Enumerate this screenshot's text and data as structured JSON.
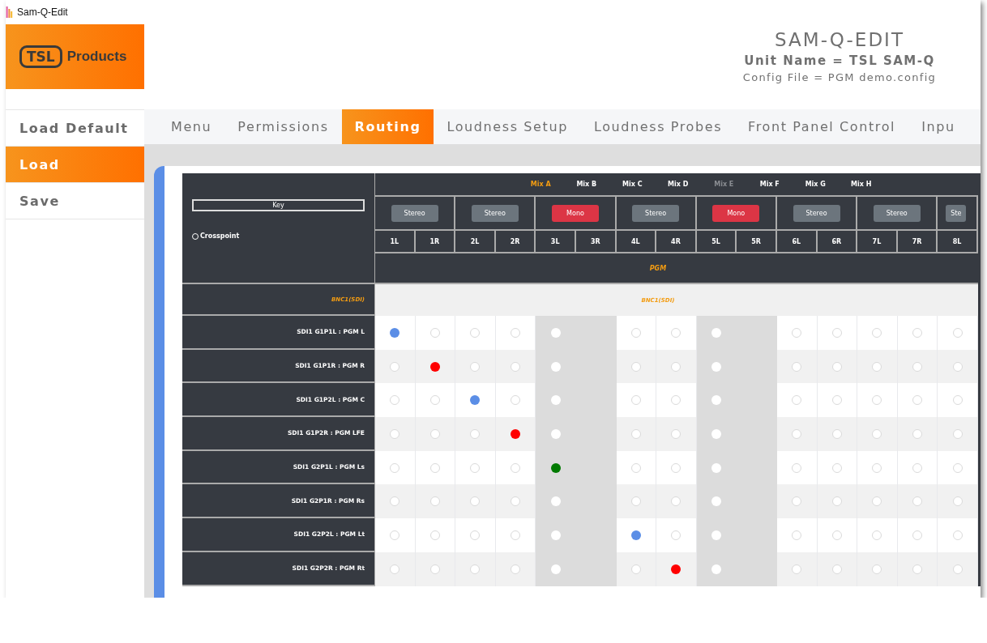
{
  "window": {
    "title": "Sam-Q-Edit"
  },
  "logo": {
    "mark": "TSL",
    "text": "Products"
  },
  "header": {
    "title": "SAM-Q-EDIT",
    "unit_name": "Unit Name = TSL SAM-Q",
    "config_file": "Config File = PGM demo.config"
  },
  "sidebar": {
    "items": [
      {
        "label": "Load Default",
        "selected": false
      },
      {
        "label": "Load",
        "selected": true
      },
      {
        "label": "Save",
        "selected": false
      }
    ]
  },
  "tabs": [
    {
      "label": "Menu",
      "selected": false
    },
    {
      "label": "Permissions",
      "selected": false
    },
    {
      "label": "Routing",
      "selected": true
    },
    {
      "label": "Loudness Setup",
      "selected": false
    },
    {
      "label": "Loudness Probes",
      "selected": false
    },
    {
      "label": "Front Panel Control",
      "selected": false
    },
    {
      "label": "Inpu",
      "selected": false
    }
  ],
  "routing": {
    "key": {
      "title": "Key",
      "crosspoint": "Crosspoint"
    },
    "mix_names": [
      {
        "label": "Mix A",
        "selected": true,
        "disabled": false
      },
      {
        "label": "Mix B",
        "selected": false,
        "disabled": false
      },
      {
        "label": "Mix C",
        "selected": false,
        "disabled": false
      },
      {
        "label": "Mix D",
        "selected": false,
        "disabled": false
      },
      {
        "label": "Mix E",
        "selected": false,
        "disabled": true
      },
      {
        "label": "Mix F",
        "selected": false,
        "disabled": false
      },
      {
        "label": "Mix G",
        "selected": false,
        "disabled": false
      },
      {
        "label": "Mix H",
        "selected": false,
        "disabled": false
      }
    ],
    "pairs": [
      {
        "mode": "Stereo",
        "kind": "stereo",
        "channels": [
          "1L",
          "1R"
        ]
      },
      {
        "mode": "Stereo",
        "kind": "stereo",
        "channels": [
          "2L",
          "2R"
        ]
      },
      {
        "mode": "Mono",
        "kind": "mono",
        "channels": [
          "3L",
          "3R"
        ]
      },
      {
        "mode": "Stereo",
        "kind": "stereo",
        "channels": [
          "4L",
          "4R"
        ]
      },
      {
        "mode": "Mono",
        "kind": "mono",
        "channels": [
          "5L",
          "5R"
        ]
      },
      {
        "mode": "Stereo",
        "kind": "stereo",
        "channels": [
          "6L",
          "6R"
        ]
      },
      {
        "mode": "Stereo",
        "kind": "stereo",
        "channels": [
          "7L",
          "7R"
        ]
      },
      {
        "mode": "Ste",
        "kind": "stereo",
        "channels": [
          "8L"
        ]
      }
    ],
    "destination": "PGM",
    "source_label": "BNC1(SDI)",
    "source_group": "BNC1(SDI)",
    "rows": [
      {
        "label": "SDI1 G1P1L : PGM L",
        "cells": [
          {
            "selected": true,
            "color": "#5b8ee6"
          },
          {
            "selected": false
          },
          {
            "selected": false
          },
          {
            "selected": false
          },
          {
            "selected": false
          },
          {
            "selected": false
          },
          {
            "selected": false
          },
          {
            "selected": false
          },
          {
            "selected": false
          },
          {
            "selected": false
          },
          {
            "selected": false
          },
          {
            "selected": false
          },
          {
            "selected": false
          },
          {
            "selected": false
          },
          {
            "selected": false
          }
        ]
      },
      {
        "label": "SDI1 G1P1R : PGM R",
        "cells": [
          {
            "selected": false
          },
          {
            "selected": true,
            "color": "#ff0000"
          },
          {
            "selected": false
          },
          {
            "selected": false
          },
          {
            "selected": false
          },
          {
            "selected": false
          },
          {
            "selected": false
          },
          {
            "selected": false
          },
          {
            "selected": false
          },
          {
            "selected": false
          },
          {
            "selected": false
          },
          {
            "selected": false
          },
          {
            "selected": false
          },
          {
            "selected": false
          },
          {
            "selected": false
          }
        ]
      },
      {
        "label": "SDI1 G1P2L : PGM C",
        "cells": [
          {
            "selected": false
          },
          {
            "selected": false
          },
          {
            "selected": true,
            "color": "#5b8ee6"
          },
          {
            "selected": false
          },
          {
            "selected": false
          },
          {
            "selected": false
          },
          {
            "selected": false
          },
          {
            "selected": false
          },
          {
            "selected": false
          },
          {
            "selected": false
          },
          {
            "selected": false
          },
          {
            "selected": false
          },
          {
            "selected": false
          },
          {
            "selected": false
          },
          {
            "selected": false
          }
        ]
      },
      {
        "label": "SDI1 G1P2R : PGM LFE",
        "cells": [
          {
            "selected": false
          },
          {
            "selected": false
          },
          {
            "selected": false
          },
          {
            "selected": true,
            "color": "#ff0000"
          },
          {
            "selected": false
          },
          {
            "selected": false
          },
          {
            "selected": false
          },
          {
            "selected": false
          },
          {
            "selected": false
          },
          {
            "selected": false
          },
          {
            "selected": false
          },
          {
            "selected": false
          },
          {
            "selected": false
          },
          {
            "selected": false
          },
          {
            "selected": false
          }
        ]
      },
      {
        "label": "SDI1 G2P1L : PGM Ls",
        "cells": [
          {
            "selected": false
          },
          {
            "selected": false
          },
          {
            "selected": false
          },
          {
            "selected": false
          },
          {
            "selected": true,
            "color": "#007a00"
          },
          {
            "selected": false
          },
          {
            "selected": false
          },
          {
            "selected": false
          },
          {
            "selected": false
          },
          {
            "selected": false
          },
          {
            "selected": false
          },
          {
            "selected": false
          },
          {
            "selected": false
          },
          {
            "selected": false
          },
          {
            "selected": false
          }
        ]
      },
      {
        "label": "SDI1 G2P1R : PGM Rs",
        "cells": [
          {
            "selected": false
          },
          {
            "selected": false
          },
          {
            "selected": false
          },
          {
            "selected": false
          },
          {
            "selected": false
          },
          {
            "selected": false
          },
          {
            "selected": false
          },
          {
            "selected": false
          },
          {
            "selected": false
          },
          {
            "selected": false
          },
          {
            "selected": false
          },
          {
            "selected": false
          },
          {
            "selected": false
          },
          {
            "selected": false
          },
          {
            "selected": false
          }
        ]
      },
      {
        "label": "SDI1 G2P2L : PGM Lt",
        "cells": [
          {
            "selected": false
          },
          {
            "selected": false
          },
          {
            "selected": false
          },
          {
            "selected": false
          },
          {
            "selected": false
          },
          {
            "selected": false
          },
          {
            "selected": true,
            "color": "#5b8ee6"
          },
          {
            "selected": false
          },
          {
            "selected": false
          },
          {
            "selected": false
          },
          {
            "selected": false
          },
          {
            "selected": false
          },
          {
            "selected": false
          },
          {
            "selected": false
          },
          {
            "selected": false
          }
        ]
      },
      {
        "label": "SDI1 G2P2R : PGM Rt",
        "cells": [
          {
            "selected": false
          },
          {
            "selected": false
          },
          {
            "selected": false
          },
          {
            "selected": false
          },
          {
            "selected": false
          },
          {
            "selected": false
          },
          {
            "selected": false
          },
          {
            "selected": true,
            "color": "#ff0000"
          },
          {
            "selected": false
          },
          {
            "selected": false
          },
          {
            "selected": false
          },
          {
            "selected": false
          },
          {
            "selected": false
          },
          {
            "selected": false
          },
          {
            "selected": false
          }
        ]
      }
    ]
  }
}
